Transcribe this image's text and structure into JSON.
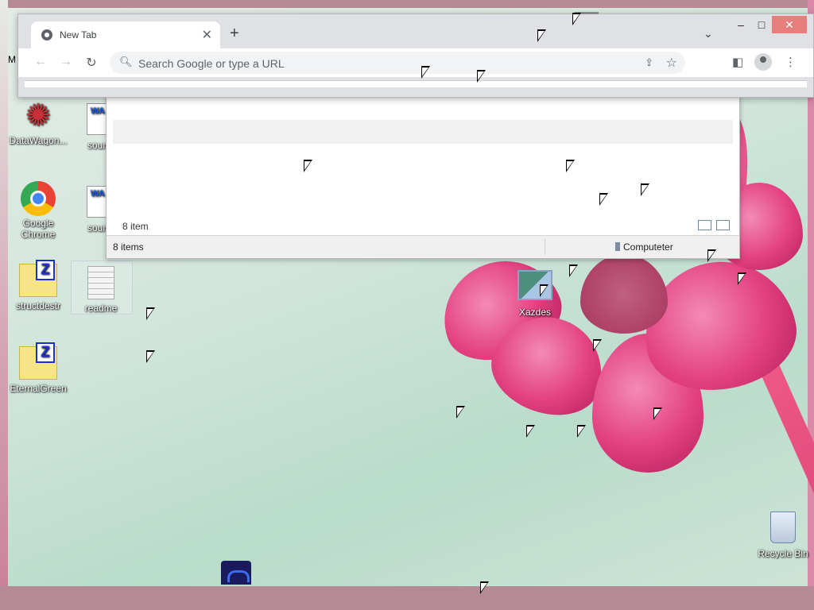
{
  "browser": {
    "tab_title": "New Tab",
    "omnibox_placeholder": "Search Google or type a URL"
  },
  "explorer": {
    "inner_status": "8 item",
    "status_count": "8 items",
    "zone": "Computeter"
  },
  "desktop_icons": {
    "datawagon": "DataWagon...",
    "chrome": "Google Chrome",
    "structdestr": "structdestr",
    "readme": "readme",
    "eternalgreen": "EternalGreen",
    "sound1": "soun",
    "sound2": "soun",
    "wav_badge": "WA",
    "xazdes": "Xazdes",
    "recycle_bin": "Recycle Bin",
    "partial_m": "M"
  },
  "icons": {
    "tab_favicon": "chrome-favicon-icon",
    "new_tab": "plus-icon",
    "tab_close": "close-icon",
    "back": "arrow-left-icon",
    "forward": "arrow-right-icon",
    "reload": "reload-icon",
    "search": "search-icon",
    "share": "share-icon",
    "bookmark": "star-icon",
    "sidepanel": "side-panel-icon",
    "profile": "profile-icon",
    "menu": "kebab-menu-icon"
  },
  "colors": {
    "flower": "#e3407f",
    "desktop_bg": "#cfe4d8",
    "chrome_frame": "#dfe1e5",
    "close_button": "#e67e7e"
  }
}
